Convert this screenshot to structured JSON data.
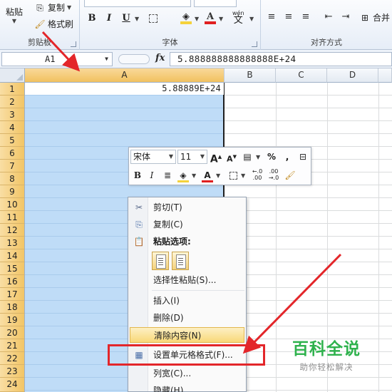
{
  "ribbon": {
    "clipboard": {
      "paste_label": "粘贴",
      "copy_label": "复制",
      "format_painter_label": "格式刷",
      "group_label": "剪贴板"
    },
    "font": {
      "bold": "B",
      "italic": "I",
      "underline": "U",
      "fill_color": "#f5d23b",
      "font_color": "#e02020",
      "phonetic_label": "wén",
      "phonetic_char": "文",
      "group_label": "字体"
    },
    "alignment": {
      "merge_label": "合并",
      "group_label": "对齐方式"
    }
  },
  "formula_bar": {
    "name_box": "A1",
    "fx_label": "fx",
    "content": "5.888888888888888E+24"
  },
  "grid": {
    "columns": [
      "A",
      "B",
      "C",
      "D"
    ],
    "rows": [
      "1",
      "2",
      "3",
      "4",
      "5",
      "6",
      "7",
      "8",
      "9",
      "10",
      "11",
      "12",
      "13",
      "14",
      "15",
      "16",
      "17",
      "18",
      "19",
      "20",
      "21",
      "22",
      "23",
      "24"
    ],
    "a1_value": "5.88889E+24"
  },
  "mini_toolbar": {
    "font_name": "宋体",
    "font_size": "11",
    "grow_font": "A",
    "shrink_font": "A",
    "percent": "%",
    "comma": ",",
    "bold": "B",
    "italic": "I",
    "increase_decimal": "←.0\n.00",
    "decrease_decimal": ".00\n→.0"
  },
  "context_menu": {
    "cut": "剪切(T)",
    "copy": "复制(C)",
    "paste_options": "粘贴选项:",
    "paste_special": "选择性粘贴(S)...",
    "insert": "插入(I)",
    "delete": "删除(D)",
    "clear_contents": "清除内容(N)",
    "format_cells": "设置单元格格式(F)...",
    "column_width": "列宽(C)...",
    "hide": "隐藏(H)"
  },
  "annotation": {
    "color": "#e3262a"
  },
  "watermark": {
    "title": "百科全说",
    "subtitle": "助你轻松解决"
  }
}
